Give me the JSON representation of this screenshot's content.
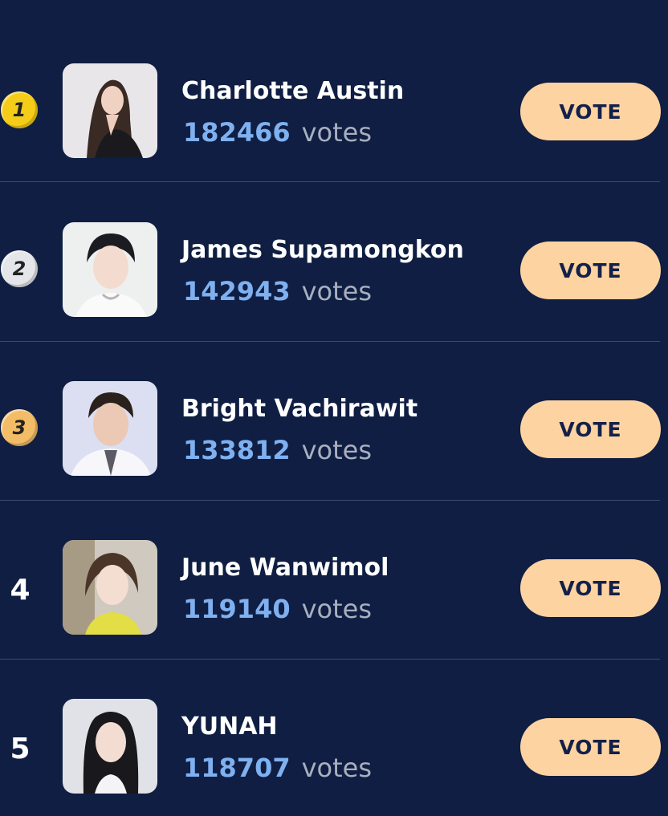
{
  "leaderboard": {
    "vote_button_label": "VOTE",
    "votes_word": "votes",
    "colors": {
      "background": "#0f1e42",
      "vote_count": "#7fb0f0",
      "vote_button": "#fdd3a1",
      "medal_gold": "#f5cc18",
      "medal_silver": "#e4e6ea",
      "medal_bronze": "#f3bc66"
    },
    "entries": [
      {
        "rank": "1",
        "name": "Charlotte Austin",
        "votes": "182466"
      },
      {
        "rank": "2",
        "name": "James Supamongkon",
        "votes": "142943"
      },
      {
        "rank": "3",
        "name": "Bright Vachirawit",
        "votes": "133812"
      },
      {
        "rank": "4",
        "name": "June Wanwimol",
        "votes": "119140"
      },
      {
        "rank": "5",
        "name": "YUNAH",
        "votes": "118707"
      }
    ]
  }
}
